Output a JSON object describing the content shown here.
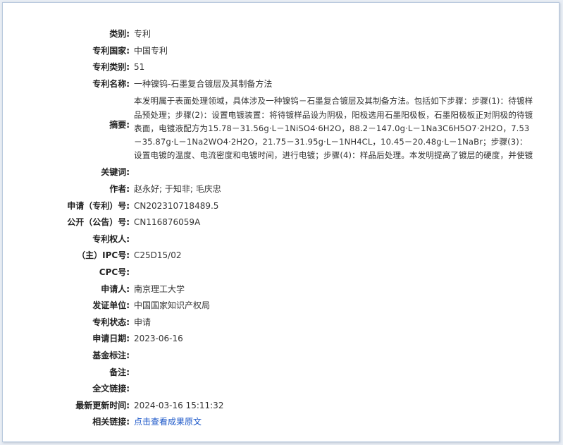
{
  "fields": {
    "type": {
      "label": "类别:",
      "value": "专利"
    },
    "country": {
      "label": "专利国家:",
      "value": "中国专利"
    },
    "patent_class": {
      "label": "专利类别:",
      "value": "51"
    },
    "name": {
      "label": "专利名称:",
      "value": "一种镍钨-石墨复合镀层及其制备方法"
    },
    "abstract": {
      "label": "摘要:",
      "value": "本发明属于表面处理领域，具体涉及一种镍钨－石墨复合镀层及其制备方法。包括如下步骤：步骤(1)：待镀样品预处理；步骤(2)：设置电镀装置：将待镀样品设为阴极，阳极选用石墨阳极板，石墨阳极板正对阴极的待镀表面，电镀液配方为15.78－31.56g·L－1NiSO4·6H2O，88.2－147.0g·L－1Na3C6H5O7·2H2O，7.53－35.87g·L－1Na2WO4·2H2O，21.75－31.95g·L－1NH4CL，10.45－20.48g·L－1NaBr；步骤(3)：设置电镀的温度、电流密度和电镀时间，进行电镀；步骤(4)：样品后处理。本发明提高了镀层的硬度，并使镀层表面光滑平整无..."
    },
    "keywords": {
      "label": "关键词:",
      "value": ""
    },
    "authors": {
      "label": "作者:",
      "value": "赵永好; 于知非; 毛庆忠"
    },
    "application_no": {
      "label": "申请（专利）号:",
      "value": "CN202310718489.5"
    },
    "publication_no": {
      "label": "公开（公告）号:",
      "value": "CN116876059A"
    },
    "patentee": {
      "label": "专利权人:",
      "value": ""
    },
    "ipc": {
      "label": "（主）IPC号:",
      "value": "C25D15/02"
    },
    "cpc": {
      "label": "CPC号:",
      "value": ""
    },
    "applicant": {
      "label": "申请人:",
      "value": "南京理工大学"
    },
    "issuer": {
      "label": "发证单位:",
      "value": "中国国家知识产权局"
    },
    "status": {
      "label": "专利状态:",
      "value": "申请"
    },
    "application_date": {
      "label": "申请日期:",
      "value": "2023-06-16"
    },
    "funding": {
      "label": "基金标注:",
      "value": ""
    },
    "remarks": {
      "label": "备注:",
      "value": ""
    },
    "fulltext_link": {
      "label": "全文链接:",
      "value": ""
    },
    "last_updated": {
      "label": "最新更新时间:",
      "value": "2024-03-16 15:11:32"
    },
    "related_link": {
      "label": "相关链接:",
      "value": "点击查看成果原文"
    }
  },
  "colors": {
    "link": "#1a56c8",
    "background": "#e9eef5",
    "panel_border": "#b9c9dd"
  }
}
